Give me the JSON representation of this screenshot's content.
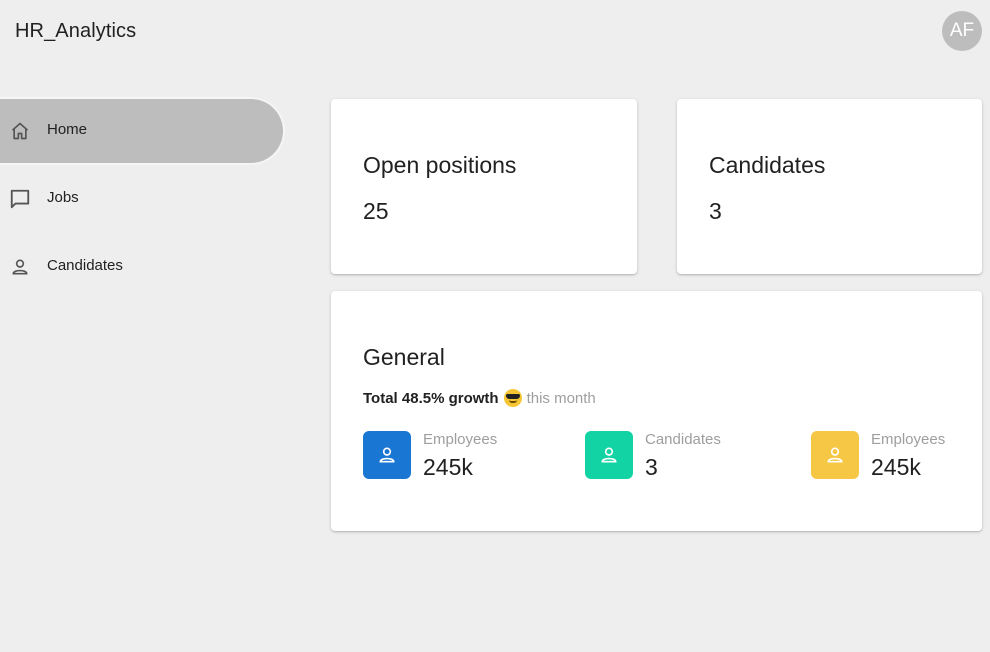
{
  "app": {
    "title": "HR_Analytics"
  },
  "user": {
    "initials": "AF"
  },
  "sidebar": {
    "items": [
      {
        "label": "Home",
        "icon": "home-icon",
        "active": true
      },
      {
        "label": "Jobs",
        "icon": "chat-bubble-icon",
        "active": false
      },
      {
        "label": "Candidates",
        "icon": "person-icon",
        "active": false
      }
    ]
  },
  "cards": {
    "open_positions": {
      "title": "Open positions",
      "value": "25"
    },
    "candidates": {
      "title": "Candidates",
      "value": "3"
    },
    "general": {
      "title": "General",
      "growth_strong": "Total 48.5% growth",
      "growth_emoji": "smiling-face-with-sunglasses",
      "growth_muted": "this month",
      "stats": [
        {
          "label": "Employees",
          "value": "245k",
          "color": "#1976d2",
          "icon": "person-icon"
        },
        {
          "label": "Candidates",
          "value": "3",
          "color": "#12d3a4",
          "icon": "person-icon"
        },
        {
          "label": "Employees",
          "value": "245k",
          "color": "#f6c744",
          "icon": "person-icon"
        }
      ]
    }
  }
}
